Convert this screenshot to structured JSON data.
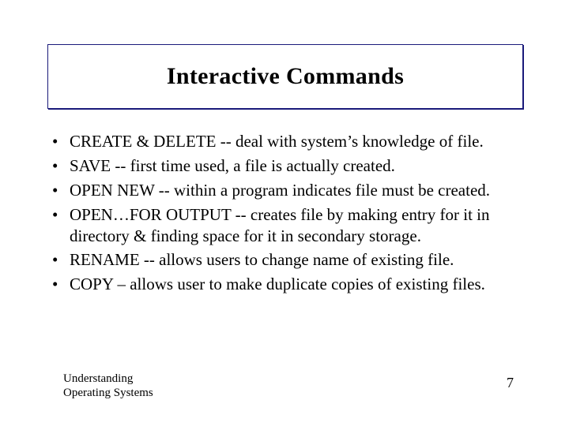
{
  "title": "Interactive Commands",
  "bullets": [
    "CREATE & DELETE -- deal with system’s knowledge of file.",
    "SAVE -- first time used, a file is actually created.",
    "OPEN NEW -- within a program indicates file must be created.",
    "OPEN…FOR OUTPUT -- creates file by making entry for it in directory & finding space for it in secondary storage.",
    "RENAME -- allows users to change name of existing file.",
    "COPY – allows user to make duplicate copies of existing files."
  ],
  "footer": {
    "left_line1": "Understanding",
    "left_line2": "Operating Systems",
    "page_number": "7"
  }
}
